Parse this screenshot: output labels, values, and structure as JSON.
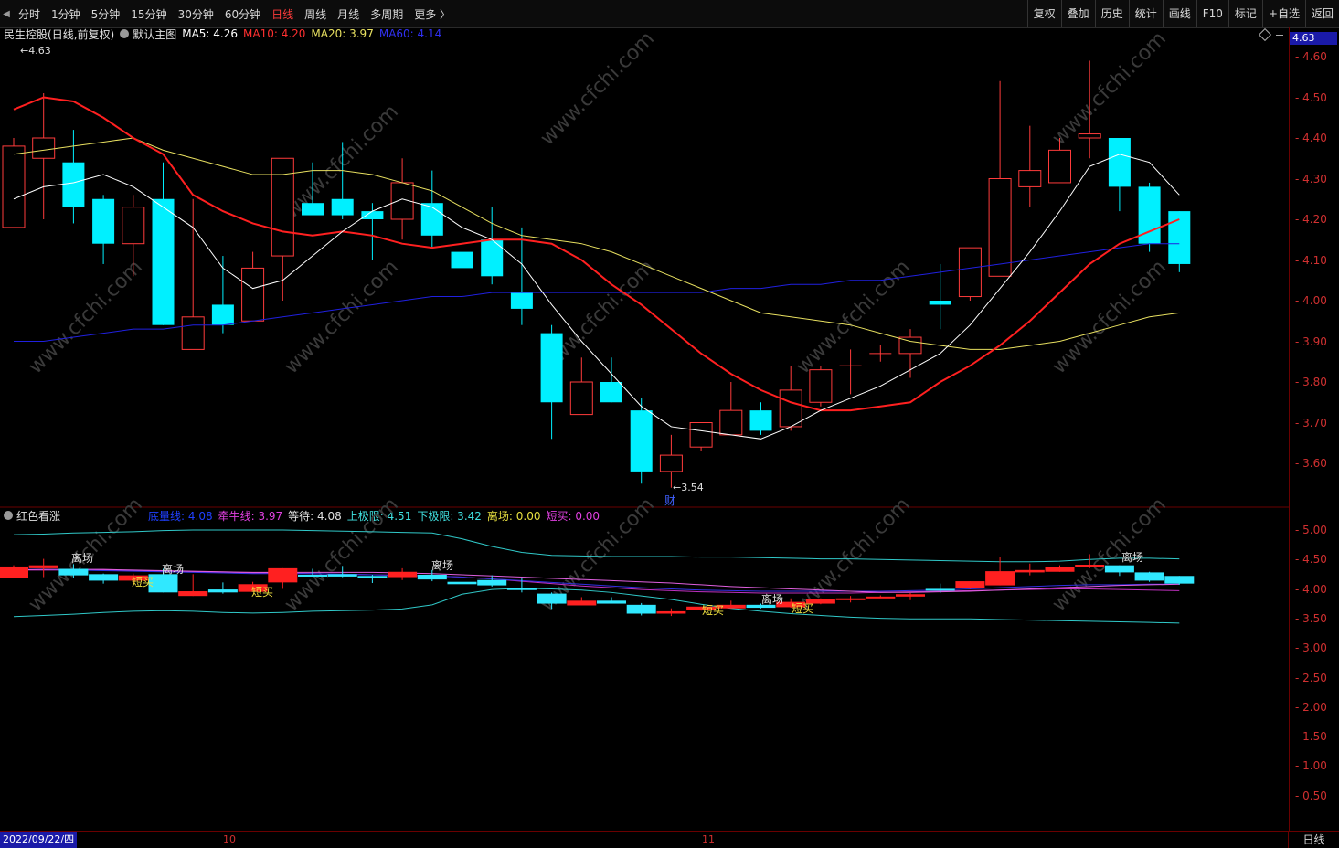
{
  "toolbar": {
    "periods": [
      "分时",
      "1分钟",
      "5分钟",
      "15分钟",
      "30分钟",
      "60分钟",
      "日线",
      "周线",
      "月线",
      "多周期",
      "更多 〉"
    ],
    "active_period": "日线",
    "right_buttons": [
      "复权",
      "叠加",
      "历史",
      "统计",
      "画线",
      "F10",
      "标记",
      "+自选",
      "返回"
    ]
  },
  "main_header": {
    "stock": "民生控股",
    "mode": "(日线,前复权)",
    "template": "默认主图",
    "ma5_label": "MA5: 4.26",
    "ma10_label": "MA10: 4.20",
    "ma20_label": "MA20: 3.97",
    "ma60_label": "MA60: 4.14"
  },
  "sub_header": {
    "name": "红色看涨",
    "l1": "底量线: 4.08",
    "l2": "牵牛线: 3.97",
    "l3": "等待: 4.08",
    "l4": "上极限: 4.51",
    "l5": "下极限: 3.42",
    "l6": "离场: 0.00",
    "l7": "短买: 0.00"
  },
  "price_tag": "4.63",
  "main_axis": [
    "4.60",
    "4.50",
    "4.40",
    "4.30",
    "4.20",
    "4.10",
    "4.00",
    "3.90",
    "3.80",
    "3.70",
    "3.60"
  ],
  "sub_axis": [
    "5.00",
    "4.50",
    "4.00",
    "3.50",
    "3.00",
    "2.50",
    "2.00",
    "1.50",
    "1.00",
    "0.50"
  ],
  "bottom": {
    "date": "2022/09/22/四",
    "month_10": "10",
    "month_11": "11",
    "period": "日线"
  },
  "annotations": {
    "high": "4.63",
    "low": "3.54",
    "cai": "财"
  },
  "signals": {
    "lichang": "离场",
    "duanmai": "短买"
  },
  "watermark": "www.cfchi.com",
  "colors": {
    "up": "#ff3b3b",
    "down": "#00f0ff",
    "ma5": "#ffffff",
    "ma10": "#ff2020",
    "ma20": "#e8e060",
    "ma60": "#2020e0"
  },
  "chart_data": {
    "type": "candlestick",
    "ylim": [
      3.5,
      4.65
    ],
    "candles": [
      {
        "o": 4.18,
        "c": 4.38,
        "h": 4.4,
        "l": 4.18
      },
      {
        "o": 4.35,
        "c": 4.4,
        "h": 4.51,
        "l": 4.2
      },
      {
        "o": 4.34,
        "c": 4.23,
        "h": 4.42,
        "l": 4.19
      },
      {
        "o": 4.25,
        "c": 4.14,
        "h": 4.26,
        "l": 4.09
      },
      {
        "o": 4.14,
        "c": 4.23,
        "h": 4.26,
        "l": 4.06
      },
      {
        "o": 4.25,
        "c": 3.94,
        "h": 4.34,
        "l": 3.94
      },
      {
        "o": 3.88,
        "c": 3.96,
        "h": 4.25,
        "l": 3.88
      },
      {
        "o": 3.99,
        "c": 3.94,
        "h": 4.11,
        "l": 3.92
      },
      {
        "o": 3.95,
        "c": 4.08,
        "h": 4.12,
        "l": 3.95
      },
      {
        "o": 4.11,
        "c": 4.35,
        "h": 4.35,
        "l": 4.0
      },
      {
        "o": 4.24,
        "c": 4.21,
        "h": 4.34,
        "l": 4.21
      },
      {
        "o": 4.25,
        "c": 4.21,
        "h": 4.39,
        "l": 4.2
      },
      {
        "o": 4.22,
        "c": 4.2,
        "h": 4.24,
        "l": 4.1
      },
      {
        "o": 4.2,
        "c": 4.29,
        "h": 4.35,
        "l": 4.15
      },
      {
        "o": 4.24,
        "c": 4.16,
        "h": 4.32,
        "l": 4.13
      },
      {
        "o": 4.12,
        "c": 4.08,
        "h": 4.12,
        "l": 4.05
      },
      {
        "o": 4.15,
        "c": 4.06,
        "h": 4.23,
        "l": 4.04
      },
      {
        "o": 4.02,
        "c": 3.98,
        "h": 4.18,
        "l": 3.94
      },
      {
        "o": 3.92,
        "c": 3.75,
        "h": 3.94,
        "l": 3.66
      },
      {
        "o": 3.72,
        "c": 3.8,
        "h": 3.86,
        "l": 3.72
      },
      {
        "o": 3.8,
        "c": 3.75,
        "h": 3.86,
        "l": 3.75
      },
      {
        "o": 3.73,
        "c": 3.58,
        "h": 3.76,
        "l": 3.55
      },
      {
        "o": 3.58,
        "c": 3.62,
        "h": 3.67,
        "l": 3.54
      },
      {
        "o": 3.64,
        "c": 3.7,
        "h": 3.7,
        "l": 3.63
      },
      {
        "o": 3.67,
        "c": 3.73,
        "h": 3.8,
        "l": 3.67
      },
      {
        "o": 3.73,
        "c": 3.68,
        "h": 3.75,
        "l": 3.67
      },
      {
        "o": 3.69,
        "c": 3.78,
        "h": 3.84,
        "l": 3.68
      },
      {
        "o": 3.75,
        "c": 3.83,
        "h": 3.84,
        "l": 3.74
      },
      {
        "o": 3.84,
        "c": 3.84,
        "h": 3.88,
        "l": 3.77
      },
      {
        "o": 3.87,
        "c": 3.87,
        "h": 3.89,
        "l": 3.85
      },
      {
        "o": 3.87,
        "c": 3.91,
        "h": 3.93,
        "l": 3.81
      },
      {
        "o": 4.0,
        "c": 3.99,
        "h": 4.09,
        "l": 3.93
      },
      {
        "o": 4.01,
        "c": 4.13,
        "h": 4.13,
        "l": 4.0
      },
      {
        "o": 4.06,
        "c": 4.3,
        "h": 4.54,
        "l": 4.06
      },
      {
        "o": 4.28,
        "c": 4.32,
        "h": 4.43,
        "l": 4.23
      },
      {
        "o": 4.29,
        "c": 4.37,
        "h": 4.4,
        "l": 4.29
      },
      {
        "o": 4.4,
        "c": 4.41,
        "h": 4.59,
        "l": 4.35
      },
      {
        "o": 4.4,
        "c": 4.28,
        "h": 4.4,
        "l": 4.22
      },
      {
        "o": 4.28,
        "c": 4.14,
        "h": 4.29,
        "l": 4.12
      },
      {
        "o": 4.22,
        "c": 4.09,
        "h": 4.22,
        "l": 4.07
      }
    ],
    "ma5": [
      4.25,
      4.28,
      4.29,
      4.31,
      4.28,
      4.23,
      4.18,
      4.08,
      4.03,
      4.05,
      4.11,
      4.17,
      4.22,
      4.25,
      4.23,
      4.18,
      4.15,
      4.09,
      3.99,
      3.9,
      3.82,
      3.74,
      3.69,
      3.68,
      3.67,
      3.66,
      3.69,
      3.73,
      3.76,
      3.79,
      3.83,
      3.87,
      3.94,
      4.03,
      4.12,
      4.22,
      4.33,
      4.36,
      4.34,
      4.26
    ],
    "ma10": [
      4.47,
      4.5,
      4.49,
      4.45,
      4.4,
      4.36,
      4.26,
      4.22,
      4.19,
      4.17,
      4.16,
      4.17,
      4.16,
      4.14,
      4.13,
      4.14,
      4.15,
      4.15,
      4.14,
      4.1,
      4.04,
      3.99,
      3.93,
      3.87,
      3.82,
      3.78,
      3.75,
      3.73,
      3.73,
      3.74,
      3.75,
      3.8,
      3.84,
      3.89,
      3.95,
      4.02,
      4.09,
      4.14,
      4.17,
      4.2
    ],
    "ma20": [
      4.36,
      4.37,
      4.38,
      4.39,
      4.4,
      4.37,
      4.35,
      4.33,
      4.31,
      4.31,
      4.32,
      4.32,
      4.31,
      4.29,
      4.27,
      4.23,
      4.19,
      4.16,
      4.15,
      4.14,
      4.12,
      4.09,
      4.06,
      4.03,
      4.0,
      3.97,
      3.96,
      3.95,
      3.94,
      3.92,
      3.9,
      3.89,
      3.88,
      3.88,
      3.89,
      3.9,
      3.92,
      3.94,
      3.96,
      3.97
    ],
    "ma60": [
      3.9,
      3.9,
      3.91,
      3.92,
      3.93,
      3.93,
      3.94,
      3.94,
      3.95,
      3.96,
      3.97,
      3.98,
      3.99,
      4.0,
      4.01,
      4.01,
      4.02,
      4.02,
      4.02,
      4.02,
      4.02,
      4.02,
      4.02,
      4.02,
      4.03,
      4.03,
      4.04,
      4.04,
      4.05,
      4.05,
      4.06,
      4.07,
      4.08,
      4.09,
      4.1,
      4.11,
      4.12,
      4.13,
      4.14,
      4.14
    ],
    "sub_ylim": [
      0.3,
      5.2
    ],
    "upper": [
      4.92,
      4.93,
      4.95,
      4.96,
      4.97,
      4.99,
      5.0,
      5.0,
      5.0,
      5.0,
      4.99,
      4.98,
      4.97,
      4.96,
      4.95,
      4.85,
      4.72,
      4.62,
      4.57,
      4.56,
      4.55,
      4.55,
      4.55,
      4.54,
      4.54,
      4.53,
      4.52,
      4.51,
      4.51,
      4.5,
      4.49,
      4.48,
      4.47,
      4.46,
      4.46,
      4.47,
      4.5,
      4.52,
      4.52,
      4.51
    ],
    "lower": [
      3.53,
      3.55,
      3.57,
      3.6,
      3.62,
      3.63,
      3.62,
      3.6,
      3.59,
      3.6,
      3.62,
      3.63,
      3.64,
      3.66,
      3.73,
      3.91,
      3.99,
      4.01,
      4.0,
      3.98,
      3.94,
      3.88,
      3.82,
      3.74,
      3.67,
      3.62,
      3.58,
      3.55,
      3.52,
      3.5,
      3.49,
      3.49,
      3.49,
      3.48,
      3.47,
      3.46,
      3.45,
      3.44,
      3.43,
      3.42
    ],
    "pink": [
      4.32,
      4.33,
      4.33,
      4.33,
      4.32,
      4.31,
      4.3,
      4.29,
      4.28,
      4.28,
      4.28,
      4.28,
      4.28,
      4.27,
      4.26,
      4.24,
      4.22,
      4.2,
      4.18,
      4.16,
      4.14,
      4.12,
      4.1,
      4.07,
      4.04,
      4.02,
      4.0,
      3.98,
      3.96,
      3.94,
      3.94,
      3.95,
      3.96,
      3.98,
      4.0,
      4.02,
      4.04,
      4.06,
      4.07,
      4.08
    ],
    "blue": [
      4.33,
      4.33,
      4.32,
      4.31,
      4.3,
      4.29,
      4.28,
      4.27,
      4.26,
      4.26,
      4.26,
      4.25,
      4.24,
      4.23,
      4.22,
      4.2,
      4.17,
      4.14,
      4.11,
      4.08,
      4.05,
      4.02,
      4.0,
      3.98,
      3.97,
      3.96,
      3.96,
      3.96,
      3.96,
      3.96,
      3.97,
      3.98,
      4.0,
      4.02,
      4.04,
      4.06,
      4.07,
      4.07,
      4.08,
      4.08
    ],
    "purple": [
      4.32,
      4.32,
      4.32,
      4.32,
      4.31,
      4.3,
      4.29,
      4.28,
      4.27,
      4.27,
      4.26,
      4.25,
      4.24,
      4.23,
      4.22,
      4.2,
      4.17,
      4.13,
      4.09,
      4.05,
      4.02,
      3.99,
      3.97,
      3.95,
      3.94,
      3.93,
      3.93,
      3.93,
      3.93,
      3.94,
      3.95,
      3.96,
      3.97,
      3.98,
      3.99,
      4.0,
      4.0,
      3.99,
      3.98,
      3.97
    ]
  }
}
